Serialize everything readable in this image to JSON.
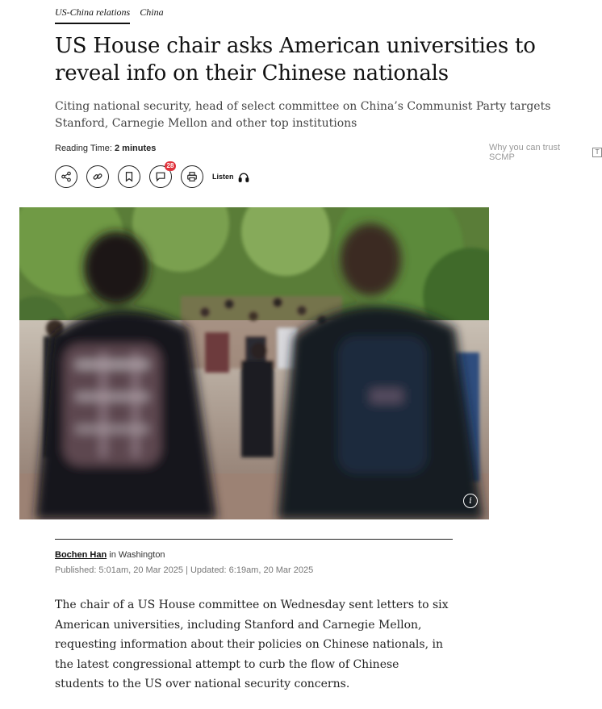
{
  "topics": [
    "US-China relations",
    "China"
  ],
  "headline": "US House chair asks American universities to reveal info on their Chinese nationals",
  "subhead": "Citing national security, head of select committee on China’s Communist Party targets Stanford, Carnegie Mellon and other top institutions",
  "reading_time": {
    "label": "Reading Time:",
    "value": "2 minutes"
  },
  "trust": {
    "label": "Why you can trust SCMP",
    "icon": "T"
  },
  "actions": {
    "comment_count": "28",
    "listen_label": "Listen",
    "icons": [
      "share-icon",
      "link-icon",
      "bookmark-icon",
      "comment-icon",
      "print-icon",
      "headphones-icon"
    ]
  },
  "photo": {
    "info_icon": "i"
  },
  "byline": {
    "author": "Bochen Han",
    "location": "in Washington",
    "dates": "Published: 5:01am, 20 Mar 2025 | Updated: 6:19am, 20 Mar 2025"
  },
  "body": "The chair of a US House committee on Wednesday sent letters to six American universities, including Stanford and Carnegie Mellon, requesting information about their policies on Chinese nationals, in the latest congressional attempt to curb the flow of Chinese students to the US over national security concerns.",
  "colors": {
    "badge": "#e0323b",
    "text": "#111111",
    "muted": "#777777"
  }
}
